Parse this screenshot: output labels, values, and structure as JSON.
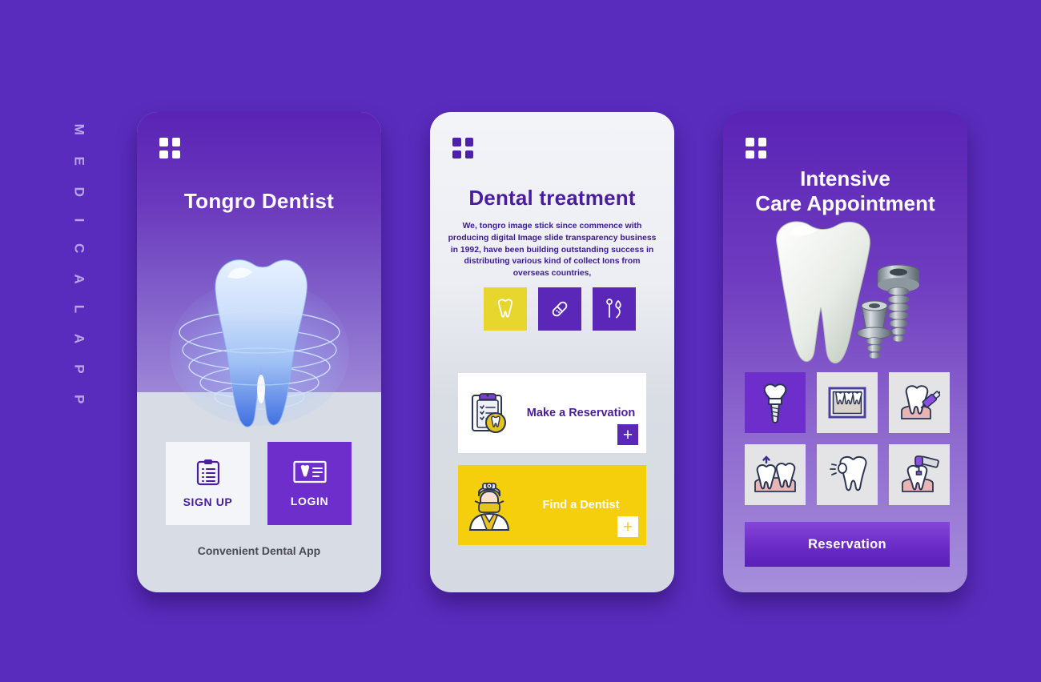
{
  "page": {
    "background_color": "#5a2cbe",
    "side_label": "M E D I C A L   A P P"
  },
  "phone1": {
    "menu_icon": "grid-menu-icon",
    "title": "Tongro Dentist",
    "hero_image": "3d-blue-tooth-scan-illustration",
    "buttons": [
      {
        "label": "SIGN UP",
        "icon": "clipboard-icon",
        "style": "light"
      },
      {
        "label": "LOGIN",
        "icon": "id-card-tooth-icon",
        "style": "purple"
      }
    ],
    "caption": "Convenient Dental App"
  },
  "phone2": {
    "menu_icon": "grid-menu-icon",
    "title": "Dental treatment",
    "body": "We, tongro image stick since commence with producing digital Image slide  transparency business in 1992, have been building outstanding success in distributing various kind of collect Ions from overseas countries,",
    "tiles": [
      {
        "icon": "tooth-icon",
        "color": "#e6d62e"
      },
      {
        "icon": "capsule-pill-icon",
        "color": "#5b27b8"
      },
      {
        "icon": "dental-tools-icon",
        "color": "#5b27b8"
      }
    ],
    "cards": [
      {
        "label": "Make a Reservation",
        "icon": "clipboard-tooth-icon",
        "plus": "+",
        "bg": "#ffffff"
      },
      {
        "label": "Find a Dentist",
        "icon": "dentist-avatar-icon",
        "plus": "+",
        "bg": "#f5cf0b"
      }
    ]
  },
  "phone3": {
    "menu_icon": "grid-menu-icon",
    "title_line1": "Intensive",
    "title_line2": "Care Appointment",
    "hero_image": "3d-tooth-and-dental-implant-screw",
    "service_icons": [
      {
        "name": "dental-implant-icon",
        "selected": true
      },
      {
        "name": "dental-xray-icon",
        "selected": false
      },
      {
        "name": "tooth-injection-icon",
        "selected": false
      },
      {
        "name": "tooth-extraction-icon",
        "selected": false
      },
      {
        "name": "tooth-whitening-icon",
        "selected": false
      },
      {
        "name": "dental-drill-icon",
        "selected": false
      }
    ],
    "reservation_button": "Reservation"
  }
}
